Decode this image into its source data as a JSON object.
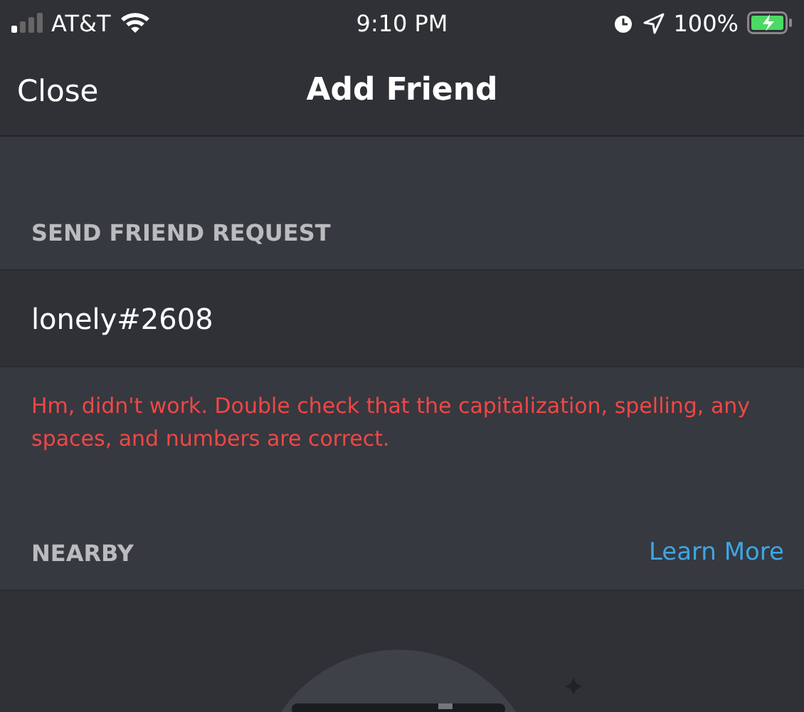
{
  "status_bar": {
    "carrier": "AT&T",
    "time": "9:10 PM",
    "battery": "100%"
  },
  "nav": {
    "close": "Close",
    "title": "Add Friend"
  },
  "send_request": {
    "heading": "SEND FRIEND REQUEST",
    "value": "lonely#2608",
    "error": "Hm, didn't work. Double check that the capitalization, spelling, any spaces, and numbers are correct."
  },
  "nearby": {
    "heading": "NEARBY",
    "link": "Learn More"
  }
}
